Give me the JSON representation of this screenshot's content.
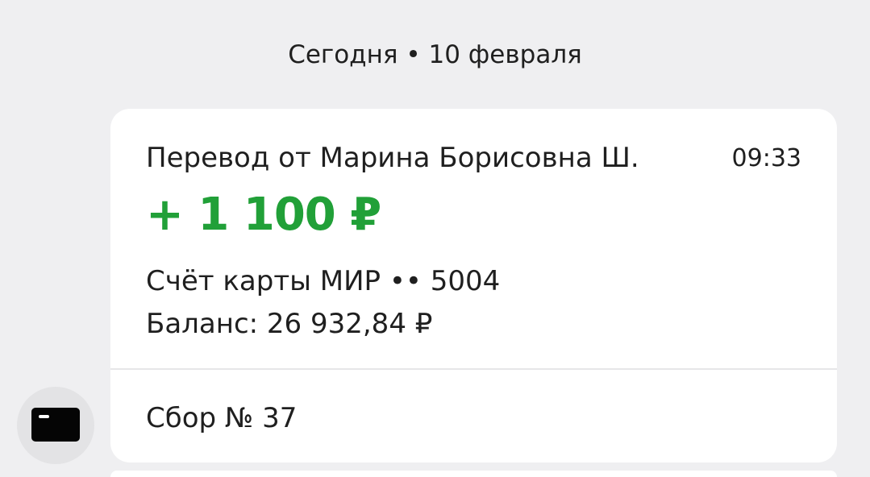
{
  "date_header": "Сегодня • 10 февраля",
  "message": {
    "title": "Перевод от Марина Борисовна Ш.",
    "time": "09:33",
    "amount": "+ 1 100 ₽",
    "account": "Счёт карты МИР •• 5004",
    "balance": "Баланс: 26 932,84 ₽",
    "collection": "Сбор № 37"
  },
  "icons": {
    "avatar": "card-icon"
  },
  "colors": {
    "background": "#efeff1",
    "card": "#ffffff",
    "amount": "#21a038",
    "text": "#1f1f1f"
  }
}
